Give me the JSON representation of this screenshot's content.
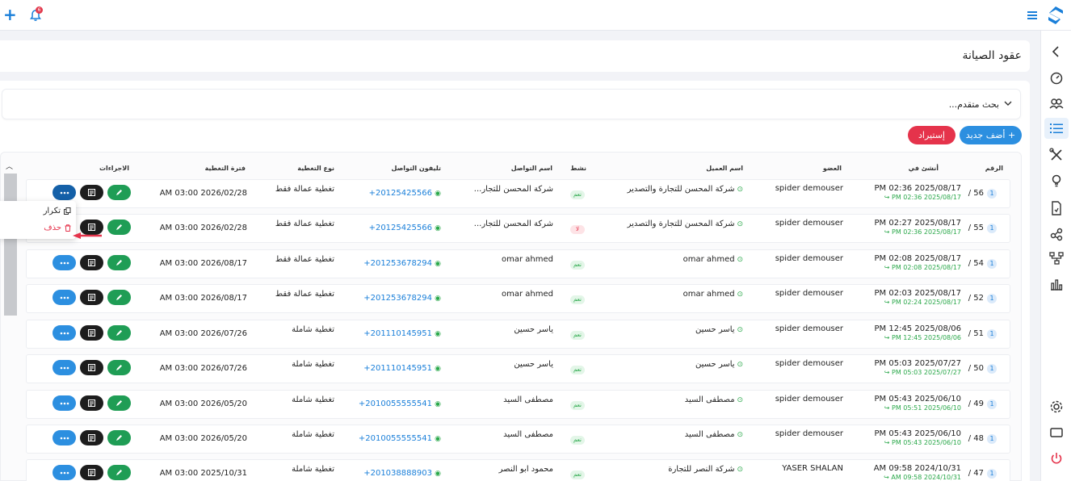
{
  "app": {
    "title": "عقود الصيانة",
    "notifications_count": "6"
  },
  "search": {
    "advanced_label": "بحث متقدم..."
  },
  "toolbar": {
    "add_label": "+ أضف جديد",
    "import_label": "إستيراد"
  },
  "table": {
    "headers": {
      "number": "الرقم",
      "created": "أنشئ في",
      "member": "العضو",
      "client": "اسم العميل",
      "active": "نشط",
      "contact_name": "اسم التواصل",
      "contact_phone": "تليفون التواصل",
      "coverage_type": "نوع التغطية",
      "coverage_period": "فترة التغطية",
      "actions": "الاجراءات"
    },
    "rows": [
      {
        "num": "56 /",
        "created": "PM 02:36 2025/08/17",
        "created_sub": "PM 02:36 2025/08/17 ↪",
        "member": "spider demouser",
        "client": "شركة المحسن للتجارة والتصدير",
        "active": "نعم",
        "contact": "شركة المحسن للتجار...",
        "phone": "+20125425566",
        "ctype": "تغطية عمالة فقط",
        "period": "AM 03:00 2026/02/28"
      },
      {
        "num": "55 /",
        "created": "PM 02:27 2025/08/17",
        "created_sub": "PM 02:36 2025/08/17 ↪",
        "member": "spider demouser",
        "client": "شركة المحسن للتجارة والتصدير",
        "active": "لا",
        "contact": "شركة المحسن للتجار...",
        "phone": "+20125425566",
        "ctype": "تغطية عمالة فقط",
        "period": "AM 03:00 2026/02/28"
      },
      {
        "num": "54 /",
        "created": "PM 02:08 2025/08/17",
        "created_sub": "PM 02:08 2025/08/17 ↪",
        "member": "spider demouser",
        "client": "omar ahmed",
        "active": "نعم",
        "contact": "omar ahmed",
        "phone": "+201253678294",
        "ctype": "تغطية عمالة فقط",
        "period": "AM 03:00 2026/08/17"
      },
      {
        "num": "52 /",
        "created": "PM 02:03 2025/08/17",
        "created_sub": "PM 02:24 2025/08/17 ↪",
        "member": "spider demouser",
        "client": "omar ahmed",
        "active": "نعم",
        "contact": "omar ahmed",
        "phone": "+201253678294",
        "ctype": "تغطية عمالة فقط",
        "period": "AM 03:00 2026/08/17"
      },
      {
        "num": "51 /",
        "created": "PM 12:45 2025/08/06",
        "created_sub": "PM 12:45 2025/08/06 ↪",
        "member": "spider demouser",
        "client": "ياسر حسين",
        "active": "نعم",
        "contact": "ياسر حسين",
        "phone": "+201110145951",
        "ctype": "تغطية شاملة",
        "period": "AM 03:00 2026/07/26"
      },
      {
        "num": "50 /",
        "created": "PM 05:03 2025/07/27",
        "created_sub": "PM 05:03 2025/07/27 ↪",
        "member": "spider demouser",
        "client": "ياسر حسين",
        "active": "نعم",
        "contact": "ياسر حسين",
        "phone": "+201110145951",
        "ctype": "تغطية شاملة",
        "period": "AM 03:00 2026/07/26"
      },
      {
        "num": "49 /",
        "created": "PM 05:43 2025/06/10",
        "created_sub": "PM 05:51 2025/06/10 ↪",
        "member": "spider demouser",
        "client": "مصطفى السيد",
        "active": "نعم",
        "contact": "مصطفى السيد",
        "phone": "+2010055555541",
        "ctype": "تغطية شاملة",
        "period": "AM 03:00 2026/05/20"
      },
      {
        "num": "48 /",
        "created": "PM 05:43 2025/06/10",
        "created_sub": "PM 05:43 2025/06/10 ↪",
        "member": "spider demouser",
        "client": "مصطفى السيد",
        "active": "نعم",
        "contact": "مصطفى السيد",
        "phone": "+2010055555541",
        "ctype": "تغطية شاملة",
        "period": "AM 03:00 2026/05/20"
      },
      {
        "num": "47 /",
        "created": "AM 09:58 2024/10/31",
        "created_sub": "AM 09:58 2024/10/31 ↪",
        "member": "YASER SHALAN",
        "client": "شركة النصر للتجارة",
        "active": "نعم",
        "contact": "محمود ابو النصر",
        "phone": "+201038888903",
        "ctype": "تغطية شاملة",
        "period": "AM 03:00 2025/10/31"
      }
    ]
  },
  "row_menu": {
    "repeat": "تكرار",
    "delete": "حذف"
  },
  "colors": {
    "primary": "#2c8fe0",
    "danger": "#e5334b",
    "success": "#1f9d55",
    "dark": "#1d1d1d"
  },
  "icons": [
    "plus-icon",
    "bell-icon",
    "menu-icon",
    "logo-icon",
    "chevron-left-icon",
    "dashboard-icon",
    "users-icon",
    "list-icon",
    "tools-icon",
    "lightbulb-icon",
    "document-icon",
    "share-icon",
    "sitemap-icon",
    "chart-icon",
    "gear-icon",
    "monitor-icon",
    "power-icon",
    "whatsapp-icon",
    "edit-icon",
    "print-icon",
    "more-icon",
    "copy-icon",
    "trash-icon"
  ]
}
